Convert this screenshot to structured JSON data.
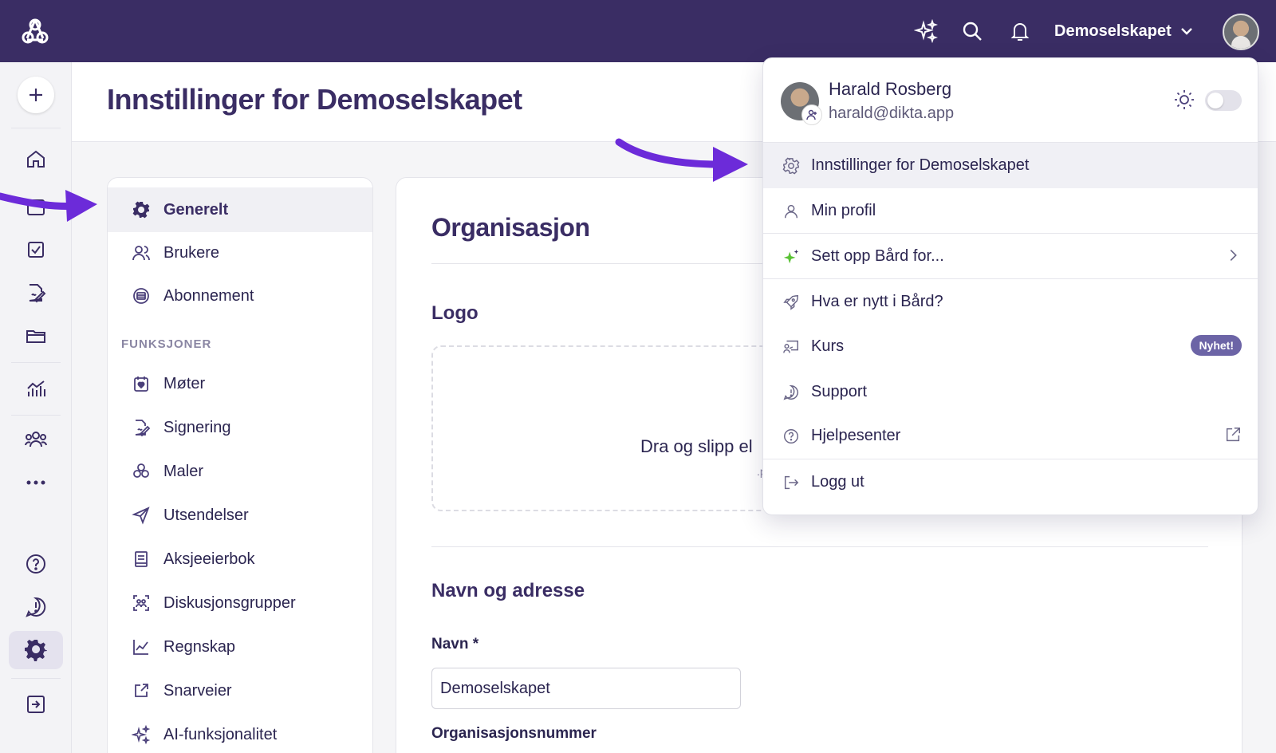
{
  "colors": {
    "topbar": "#3a2d64",
    "accent": "#6c2bd9",
    "title": "#3a2d64",
    "badge": "#6c64a6",
    "ai_star": "#5bc236"
  },
  "topbar": {
    "org_name": "Demoselskapet",
    "icons": [
      "sparkles-icon",
      "search-icon",
      "bell-icon",
      "chevron-down-icon"
    ]
  },
  "header": {
    "title": "Innstillinger for Demoselskapet"
  },
  "settings_nav": {
    "items": [
      {
        "label": "Generelt",
        "icon": "gear-icon",
        "active": true
      },
      {
        "label": "Brukere",
        "icon": "users-icon"
      },
      {
        "label": "Abonnement",
        "icon": "subscription-icon"
      }
    ],
    "section_label": "FUNKSJONER",
    "features": [
      {
        "label": "Møter",
        "icon": "calendar-heart-icon"
      },
      {
        "label": "Signering",
        "icon": "signature-icon"
      },
      {
        "label": "Maler",
        "icon": "templates-icon"
      },
      {
        "label": "Utsendelser",
        "icon": "send-icon"
      },
      {
        "label": "Aksjeeierbok",
        "icon": "book-icon"
      },
      {
        "label": "Diskusjonsgrupper",
        "icon": "discussion-icon"
      },
      {
        "label": "Regnskap",
        "icon": "chart-line-icon"
      },
      {
        "label": "Snarveier",
        "icon": "shortcut-icon"
      },
      {
        "label": "AI-funksjonalitet",
        "icon": "sparkles-icon"
      }
    ]
  },
  "content": {
    "title": "Organisasjon",
    "logo_heading": "Logo",
    "dropzone_text": "Dra og slipp el",
    "dropzone_sub": ".p",
    "address_heading": "Navn og adresse",
    "name_label": "Navn *",
    "name_value": "Demoselskapet",
    "orgnr_label": "Organisasjonsnummer"
  },
  "menu": {
    "user_name": "Harald Rosberg",
    "user_email": "harald@dikta.app",
    "items": [
      {
        "label": "Innstillinger for Demoselskapet",
        "icon": "gear-icon",
        "active": true
      },
      {
        "label": "Min profil",
        "icon": "user-icon"
      },
      {
        "label": "Sett opp Bård for...",
        "icon": "sparkle-star-icon",
        "trail": "chevron-right-icon"
      },
      {
        "label": "Hva er nytt i Bård?",
        "icon": "rocket-icon"
      },
      {
        "label": "Kurs",
        "icon": "presentation-icon",
        "badge": "Nyhet!"
      },
      {
        "label": "Support",
        "icon": "support-icon"
      },
      {
        "label": "Hjelpesenter",
        "icon": "help-circle-icon",
        "trail": "external-link-icon"
      },
      {
        "label": "Logg ut",
        "icon": "logout-icon"
      }
    ]
  }
}
